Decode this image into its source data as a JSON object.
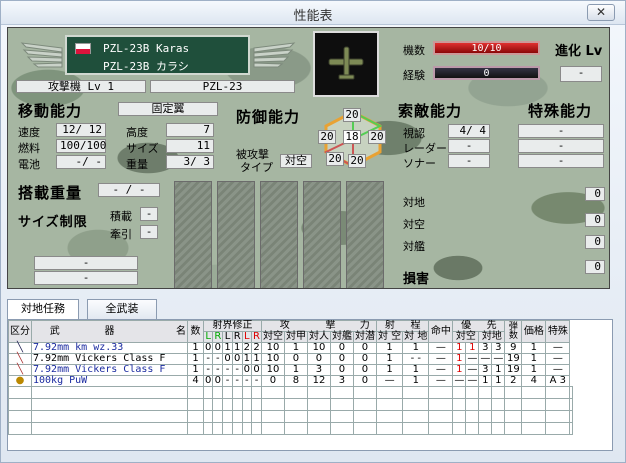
{
  "window": {
    "title": "性能表",
    "close": "✕"
  },
  "unit": {
    "name_line1": "PZL-23B Karas",
    "name_line2": "PZL-23B カラシ",
    "type": "攻撃機 Lv 1",
    "model": "PZL-23",
    "flag_colors": [
      "#ffffff",
      "#dc143c"
    ]
  },
  "bars": {
    "count_label": "機数",
    "count_value": "10/10",
    "exp_label": "経験",
    "exp_value": "0",
    "count_fill_fraction": 1.0,
    "exp_fill_fraction": 0.0
  },
  "evolve": {
    "label": "進化 Lv",
    "value": "-"
  },
  "mobility": {
    "header": "移動能力",
    "fixed": "固定翼",
    "speed_label": "速度",
    "speed": "12/ 12",
    "altitude_label": "高度",
    "altitude": "7",
    "fuel_label": "燃料",
    "fuel": "100/100",
    "size_label": "サイズ",
    "size": "11",
    "battery_label": "電池",
    "battery": "-/ -",
    "weight_label": "重量",
    "weight": "3/ 3"
  },
  "defense": {
    "header": "防御能力",
    "hit_label_1": "被攻撃",
    "hit_label_2": "タイプ",
    "hit_type": "対空",
    "hex_top": "20",
    "hex_center": "18",
    "hex_left": "20",
    "hex_right": "20",
    "hex_bottom_left": "20",
    "hex_bottom_right": "20"
  },
  "search": {
    "header": "索敵能力",
    "visual_label": "視認",
    "visual": "4/ 4",
    "radar_label": "レーダー",
    "radar": "-",
    "sonar_label": "ソナー",
    "sonar": "-"
  },
  "special": {
    "header": "特殊能力",
    "rows": [
      "-",
      "-",
      "-"
    ]
  },
  "payload": {
    "header": "搭載重量",
    "value": "- / -",
    "size_header": "サイズ制限",
    "carry_label": "積載",
    "carry": "-",
    "tow_label": "牽引",
    "tow": "-",
    "bottom1": "-",
    "bottom2": "-"
  },
  "targets": {
    "ground_label": "対地",
    "ground": "0",
    "air_label": "対空",
    "air": "0",
    "ship_label": "対艦",
    "ship": "0",
    "dmg_label": "損害",
    "dmg": "0",
    "extra": "0"
  },
  "tabs": [
    "対地任務",
    "全武装"
  ],
  "table": {
    "h1": [
      "区分",
      "武",
      "器",
      "名",
      "数",
      "射界修正",
      "攻",
      "撃",
      "力",
      "射",
      "程",
      "命中",
      "優",
      "先",
      "弾数",
      "価格",
      "特殊"
    ],
    "h2": [
      "L",
      "R",
      "L",
      "R",
      "L",
      "R",
      "対空",
      "対甲",
      "対人",
      "対艦",
      "対潜",
      "対 空",
      "対 地",
      "対空",
      "対地"
    ],
    "rows": [
      {
        "name": "7.92mm km wz.33",
        "num": "1",
        "f": [
          "0",
          "0",
          "1",
          "1",
          "2",
          "2"
        ],
        "atk": [
          "10",
          "1",
          "10",
          "0",
          "0"
        ],
        "rng": [
          "1",
          "",
          "1"
        ],
        "hit": "—",
        "pri": [
          "1",
          "1",
          "3",
          "3"
        ],
        "ammo": "9",
        "price": "1",
        "sp": "—",
        "blue": true
      },
      {
        "name": "7.92mm Vickers Class F",
        "num": "1",
        "f": [
          "-",
          "-",
          "0",
          "0",
          "1",
          "1"
        ],
        "atk": [
          "10",
          "0",
          "0",
          "0",
          "0"
        ],
        "rng": [
          "1",
          "-",
          "-"
        ],
        "hit": "—",
        "pri": [
          "1",
          "—",
          "—",
          "—"
        ],
        "ammo": "19",
        "price": "1",
        "sp": "—",
        "blue": false
      },
      {
        "name": "7.92mm Vickers Class F",
        "num": "1",
        "f": [
          "-",
          "-",
          "-",
          "-",
          "0",
          "0"
        ],
        "atk": [
          "10",
          "1",
          "3",
          "0",
          "0"
        ],
        "rng": [
          "1",
          "",
          "1"
        ],
        "hit": "—",
        "pri": [
          "1",
          "—",
          "3",
          "1"
        ],
        "ammo": "19",
        "price": "1",
        "sp": "—",
        "blue": true
      },
      {
        "name": "100kg PuW",
        "num": "4",
        "f": [
          "0",
          "0",
          "-",
          "-",
          "-",
          "-"
        ],
        "atk": [
          "0",
          "8",
          "12",
          "3",
          "0"
        ],
        "rng": [
          "—",
          "",
          "1"
        ],
        "hit": "—",
        "pri": [
          "—",
          "—",
          "1",
          "1"
        ],
        "ammo": "2",
        "price": "4",
        "sp": "A 3",
        "blue": true
      }
    ]
  }
}
